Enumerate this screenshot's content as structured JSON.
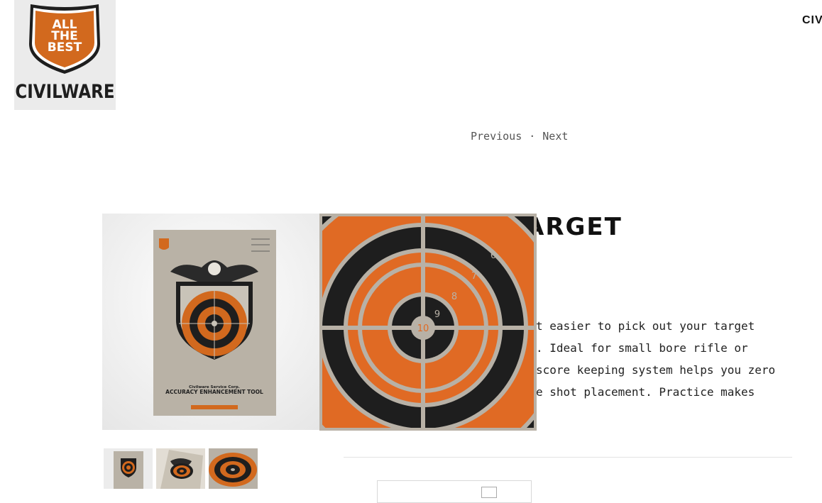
{
  "brand": {
    "badge_lines": [
      "ALL",
      "THE",
      "BEST"
    ],
    "wordmark": "CIVILWARE",
    "top_right_label": "CIV",
    "colors": {
      "orange": "#d2691e",
      "dark": "#1e1e1e",
      "tan": "#b8b1a6"
    }
  },
  "pager": {
    "previous": "Previous",
    "separator": "·",
    "next": "Next"
  },
  "product": {
    "title_visible": "ARGET",
    "description_lines": [
      "t easier to pick out your target",
      ". Ideal for small bore rifle or",
      "score keeping system helps you zero",
      "e shot placement. Practice makes"
    ]
  },
  "poster": {
    "company": "Civilware Service Corp.",
    "tool": "ACCURACY ENHANCEMENT TOOL"
  },
  "zoom": {
    "rings": [
      "6",
      "7",
      "8",
      "9",
      "10"
    ]
  },
  "thumbnails": [
    "thumb-front",
    "thumb-angle",
    "thumb-closeup"
  ]
}
